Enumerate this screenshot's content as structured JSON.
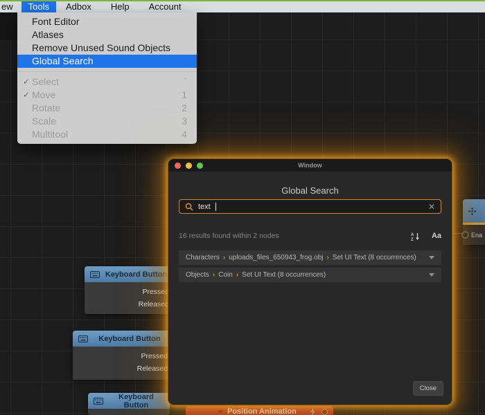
{
  "menubar": {
    "items": [
      {
        "label": "ew"
      },
      {
        "label": "Tools"
      },
      {
        "label": "Adbox"
      },
      {
        "label": "Help"
      },
      {
        "label": "Account"
      }
    ]
  },
  "tools_menu": {
    "check_glyph": "✓",
    "group1": [
      {
        "label": "Font Editor"
      },
      {
        "label": "Atlases"
      },
      {
        "label": "Remove Unused Sound Objects"
      },
      {
        "label": "Global Search"
      }
    ],
    "group2": [
      {
        "label": "Select",
        "shortcut": "`"
      },
      {
        "label": "Move",
        "shortcut": "1"
      },
      {
        "label": "Rotate",
        "shortcut": "2"
      },
      {
        "label": "Scale",
        "shortcut": "3"
      },
      {
        "label": "Multitool",
        "shortcut": "4"
      }
    ]
  },
  "modal": {
    "titlebar": "Window",
    "heading": "Global Search",
    "search": {
      "value": "text",
      "clear_glyph": "✕"
    },
    "results_summary": "16 results found within 2 nodes",
    "case_toggle": "Aa",
    "breadcrumb_separator": "›",
    "results": [
      {
        "path": [
          "Characters",
          "uploads_files_650943_frog.obj",
          "Set UI Text (8 occurrences)"
        ]
      },
      {
        "path": [
          "Objects",
          "Coin",
          "Set UI Text (8 occurrences)"
        ]
      }
    ],
    "close_label": "Close"
  },
  "canvas": {
    "nodes": [
      {
        "title": "Keyboard Button",
        "outputs": [
          "Pressed",
          "Released"
        ]
      },
      {
        "title": "Keyboard Button",
        "outputs": [
          "Pressed",
          "Released"
        ]
      },
      {
        "title": "Keyboard Button"
      }
    ],
    "position_node": {
      "title": "Position Animation"
    },
    "side_panel": {
      "label": "Ena"
    }
  },
  "colors": {
    "accent_orange": "#c98a2c",
    "glow": "#e8a02a",
    "menu_highlight_blue": "#1e74e8",
    "node_header_blue": "#5f8db6",
    "position_node_red": "#bf3a2e",
    "canvas_bg": "#1d1d1d",
    "modal_bg": "#282828"
  }
}
